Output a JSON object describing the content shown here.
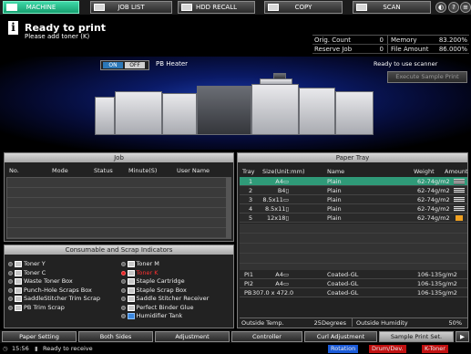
{
  "tabs": [
    {
      "label": "MACHINE",
      "icon": "machine-icon",
      "active": true
    },
    {
      "label": "JOB LIST",
      "icon": "job-list-icon",
      "active": false
    },
    {
      "label": "HDD RECALL",
      "icon": "hdd-icon",
      "active": false
    },
    {
      "label": "COPY",
      "icon": "copy-icon",
      "active": false
    },
    {
      "label": "SCAN",
      "icon": "scan-icon",
      "active": false
    }
  ],
  "header_buttons": {
    "volume": "◐",
    "help": "?",
    "menu": "≡"
  },
  "status": {
    "title": "Ready to print",
    "subtitle": "Please add toner (K)",
    "orig_count_label": "Orig. Count",
    "orig_count": "0",
    "memory_label": "Memory",
    "memory": "83.200%",
    "reserve_job_label": "Reserve Job",
    "reserve_job": "0",
    "file_amount_label": "File Amount",
    "file_amount": "86.000%"
  },
  "machine": {
    "on_label": "ON",
    "off_label": "OFF",
    "pb_heater_label": "PB Heater",
    "scanner_status": "Ready to use scanner",
    "sample_print_label": "Execute Sample Print"
  },
  "job": {
    "title": "Job",
    "columns": [
      "No.",
      "Mode",
      "Status",
      "Minute(S)",
      "User Name"
    ]
  },
  "consumables": {
    "title": "Consumable and Scrap Indicators",
    "items": [
      {
        "left": "Toner Y",
        "left_alert": false,
        "right": "Toner M",
        "right_alert": false
      },
      {
        "left": "Toner C",
        "left_alert": false,
        "right": "Toner K",
        "right_alert": true
      },
      {
        "left": "Waste Toner Box",
        "left_alert": false,
        "right": "Staple Cartridge",
        "right_alert": false
      },
      {
        "left": "Punch-Hole Scraps Box",
        "left_alert": false,
        "right": "Staple Scrap Box",
        "right_alert": false
      },
      {
        "left": "SaddleStitcher Trim Scrap",
        "left_alert": false,
        "right": "Saddle Stitcher Receiver",
        "right_alert": false
      },
      {
        "left": "PB Trim Scrap",
        "left_alert": false,
        "right": "Perfect Binder Glue",
        "right_alert": false
      },
      {
        "left": "",
        "left_alert": false,
        "right": "Humidifier Tank",
        "right_alert": false
      }
    ]
  },
  "paper_tray": {
    "title": "Paper Tray",
    "columns": {
      "tray": "Tray",
      "size": "Size(Unit:mm)",
      "name": "Name",
      "weight": "Weight",
      "amount": "Amount"
    },
    "trays": [
      {
        "tray": "1",
        "size": "A4▭",
        "name": "Plain",
        "weight": "62-74g/m2",
        "selected": true,
        "warn": false
      },
      {
        "tray": "2",
        "size": "B4▯",
        "name": "Plain",
        "weight": "62-74g/m2",
        "selected": false,
        "warn": false
      },
      {
        "tray": "3",
        "size": "8.5x11▭",
        "name": "Plain",
        "weight": "62-74g/m2",
        "selected": false,
        "warn": false
      },
      {
        "tray": "4",
        "size": "8.5x11▯",
        "name": "Plain",
        "weight": "62-74g/m2",
        "selected": false,
        "warn": false
      },
      {
        "tray": "5",
        "size": "12x18▯",
        "name": "Plain",
        "weight": "62-74g/m2",
        "selected": false,
        "warn": true
      }
    ],
    "special_trays": [
      {
        "tray": "PI1",
        "size": "A4▭",
        "name": "Coated-GL",
        "weight": "106-135g/m2"
      },
      {
        "tray": "PI2",
        "size": "A4▭",
        "name": "Coated-GL",
        "weight": "106-135g/m2"
      },
      {
        "tray": "PB",
        "size": "307.0 x 472.0",
        "name": "Coated-GL",
        "weight": "106-135g/m2"
      }
    ],
    "outside_temp_label": "Outside Temp.",
    "outside_temp": "25Degrees",
    "outside_humidity_label": "Outside Humidity",
    "outside_humidity": "50%"
  },
  "function_bar": [
    {
      "label": "Paper Setting",
      "lit": false
    },
    {
      "label": "Both Sides",
      "lit": false
    },
    {
      "label": "Adjustment",
      "lit": false
    },
    {
      "label": "Controller",
      "lit": false
    },
    {
      "label": "Curl Adjustment",
      "lit": false
    },
    {
      "label": "Sample Print Set.",
      "lit": true
    },
    {
      "label": "▶",
      "lit": false
    }
  ],
  "status_bar": {
    "time": "15:56",
    "message": "Ready to receive",
    "rotation": "Rotation",
    "drum": "Drum/Dev.",
    "ktoner": "K-Toner",
    "accent_rotation": "#1a5ad8",
    "accent_alert": "#c01010"
  }
}
